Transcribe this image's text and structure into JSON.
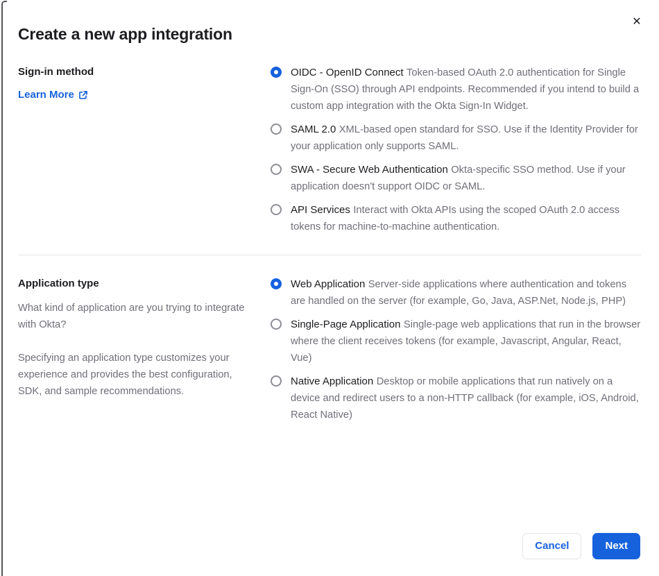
{
  "dialog": {
    "title": "Create a new app integration",
    "close_icon": "✕"
  },
  "colors": {
    "accent": "#1662dd",
    "heading": "#1d1d21",
    "body_text": "#6f6f78",
    "divider": "#e2e2e6",
    "frame": "#54555c"
  },
  "sections": [
    {
      "label": "Sign-in method",
      "link_label": "Learn More",
      "link_icon": "external-link-icon",
      "options": [
        {
          "title": "OIDC - OpenID Connect",
          "description": "Token-based OAuth 2.0 authentication for Single Sign-On (SSO) through API endpoints. Recommended if you intend to build a custom app integration with the Okta Sign-In Widget.",
          "selected": true
        },
        {
          "title": "SAML 2.0",
          "description": "XML-based open standard for SSO. Use if the Identity Provider for your application only supports SAML.",
          "selected": false
        },
        {
          "title": "SWA - Secure Web Authentication",
          "description": "Okta-specific SSO method. Use if your application doesn't support OIDC or SAML.",
          "selected": false
        },
        {
          "title": "API Services",
          "description": "Interact with Okta APIs using the scoped OAuth 2.0 access tokens for machine-to-machine authentication.",
          "selected": false
        }
      ]
    },
    {
      "label": "Application type",
      "paragraphs": [
        "What kind of application are you trying to integrate with Okta?",
        "Specifying an application type customizes your experience and provides the best configuration, SDK, and sample recommendations."
      ],
      "options": [
        {
          "title": "Web Application",
          "description": "Server-side applications where authentication and tokens are handled on the server (for example, Go, Java, ASP.Net, Node.js, PHP)",
          "selected": true
        },
        {
          "title": "Single-Page Application",
          "description": "Single-page web applications that run in the browser where the client receives tokens (for example, Javascript, Angular, React, Vue)",
          "selected": false
        },
        {
          "title": "Native Application",
          "description": "Desktop or mobile applications that run natively on a device and redirect users to a non-HTTP callback (for example, iOS, Android, React Native)",
          "selected": false
        }
      ]
    }
  ],
  "footer": {
    "cancel_label": "Cancel",
    "next_label": "Next"
  }
}
